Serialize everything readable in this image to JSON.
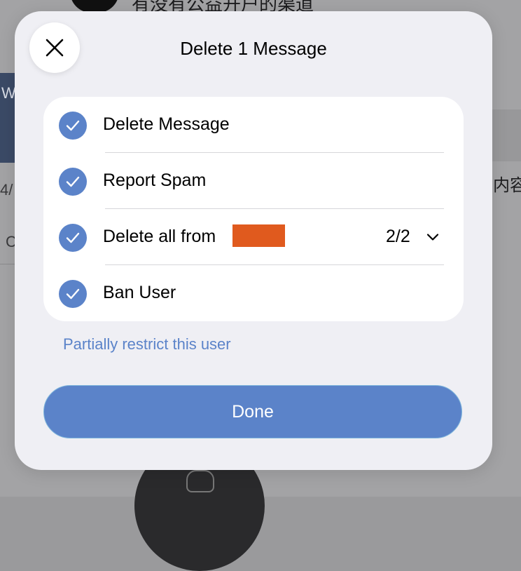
{
  "background": {
    "top_text": "有没有公益开户的渠道",
    "left_band_text": "W",
    "left_text_1": "4/",
    "left_text_2": "C",
    "right_text": "内容"
  },
  "dialog": {
    "title": "Delete 1 Message",
    "options": [
      {
        "label": "Delete Message",
        "checked": true
      },
      {
        "label": "Report Spam",
        "checked": true
      },
      {
        "label": "Delete all from",
        "checked": true,
        "count": "2/2"
      },
      {
        "label": "Ban User",
        "checked": true
      }
    ],
    "restrict_link": "Partially restrict this user",
    "done_label": "Done"
  },
  "colors": {
    "accent": "#5b83c9",
    "sheet_bg": "#efeff4",
    "card_bg": "#ffffff",
    "redaction": "#e05a1e"
  },
  "icons": {
    "close": "close-icon",
    "check": "checkmark-icon",
    "expand": "chevron-down-icon"
  }
}
